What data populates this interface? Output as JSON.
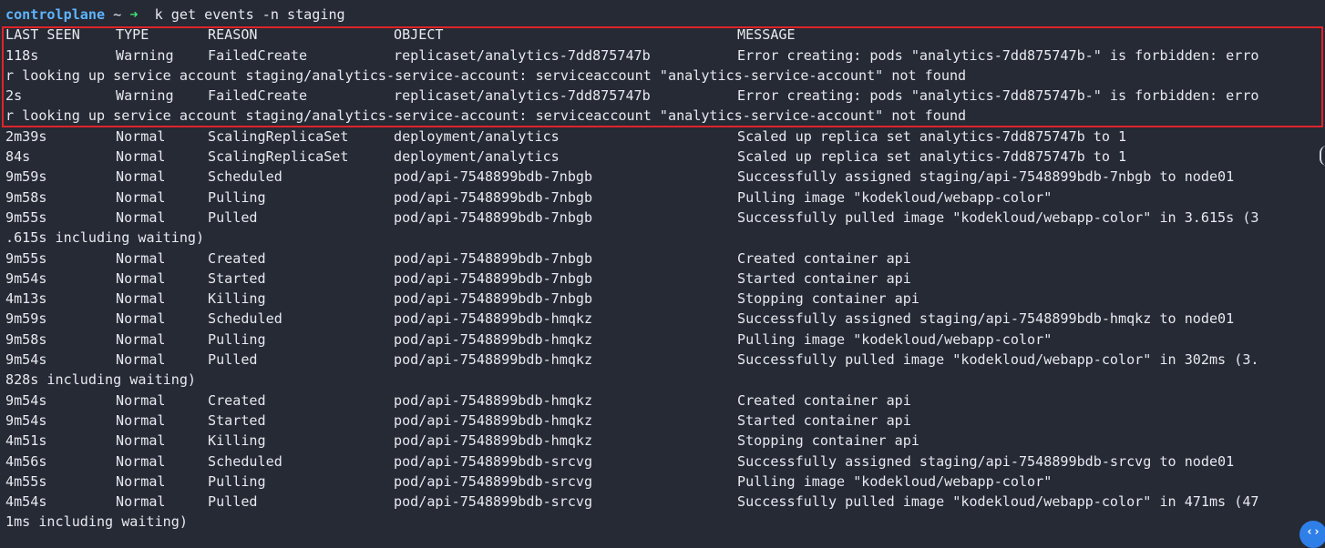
{
  "terminal": {
    "prompt": {
      "host": "controlplane",
      "tilde": "~",
      "arrow": "➜",
      "command": "k get events -n staging"
    },
    "header": {
      "last_seen": "LAST SEEN",
      "type": "TYPE",
      "reason": "REASON",
      "object": "OBJECT",
      "message": "MESSAGE"
    },
    "rows": [
      {
        "kind": "row",
        "last_seen": "118s",
        "type": "Warning",
        "reason": "FailedCreate",
        "object": "replicaset/analytics-7dd875747b",
        "message": "Error creating: pods \"analytics-7dd875747b-\" is forbidden: erro"
      },
      {
        "kind": "wrap",
        "text": "r looking up service account staging/analytics-service-account: serviceaccount \"analytics-service-account\" not found"
      },
      {
        "kind": "row",
        "last_seen": "2s",
        "type": "Warning",
        "reason": "FailedCreate",
        "object": "replicaset/analytics-7dd875747b",
        "message": "Error creating: pods \"analytics-7dd875747b-\" is forbidden: erro"
      },
      {
        "kind": "wrap",
        "text": "r looking up service account staging/analytics-service-account: serviceaccount \"analytics-service-account\" not found"
      },
      {
        "kind": "row",
        "last_seen": "2m39s",
        "type": "Normal",
        "reason": "ScalingReplicaSet",
        "object": "deployment/analytics",
        "message": "Scaled up replica set analytics-7dd875747b to 1"
      },
      {
        "kind": "row",
        "last_seen": "84s",
        "type": "Normal",
        "reason": "ScalingReplicaSet",
        "object": "deployment/analytics",
        "message": "Scaled up replica set analytics-7dd875747b to 1"
      },
      {
        "kind": "row",
        "last_seen": "9m59s",
        "type": "Normal",
        "reason": "Scheduled",
        "object": "pod/api-7548899bdb-7nbgb",
        "message": "Successfully assigned staging/api-7548899bdb-7nbgb to node01"
      },
      {
        "kind": "row",
        "last_seen": "9m58s",
        "type": "Normal",
        "reason": "Pulling",
        "object": "pod/api-7548899bdb-7nbgb",
        "message": "Pulling image \"kodekloud/webapp-color\""
      },
      {
        "kind": "row",
        "last_seen": "9m55s",
        "type": "Normal",
        "reason": "Pulled",
        "object": "pod/api-7548899bdb-7nbgb",
        "message": "Successfully pulled image \"kodekloud/webapp-color\" in 3.615s (3"
      },
      {
        "kind": "wrap",
        "text": ".615s including waiting)"
      },
      {
        "kind": "row",
        "last_seen": "9m55s",
        "type": "Normal",
        "reason": "Created",
        "object": "pod/api-7548899bdb-7nbgb",
        "message": "Created container api"
      },
      {
        "kind": "row",
        "last_seen": "9m54s",
        "type": "Normal",
        "reason": "Started",
        "object": "pod/api-7548899bdb-7nbgb",
        "message": "Started container api"
      },
      {
        "kind": "row",
        "last_seen": "4m13s",
        "type": "Normal",
        "reason": "Killing",
        "object": "pod/api-7548899bdb-7nbgb",
        "message": "Stopping container api"
      },
      {
        "kind": "row",
        "last_seen": "9m59s",
        "type": "Normal",
        "reason": "Scheduled",
        "object": "pod/api-7548899bdb-hmqkz",
        "message": "Successfully assigned staging/api-7548899bdb-hmqkz to node01"
      },
      {
        "kind": "row",
        "last_seen": "9m58s",
        "type": "Normal",
        "reason": "Pulling",
        "object": "pod/api-7548899bdb-hmqkz",
        "message": "Pulling image \"kodekloud/webapp-color\""
      },
      {
        "kind": "row",
        "last_seen": "9m54s",
        "type": "Normal",
        "reason": "Pulled",
        "object": "pod/api-7548899bdb-hmqkz",
        "message": "Successfully pulled image \"kodekloud/webapp-color\" in 302ms (3."
      },
      {
        "kind": "wrap",
        "text": "828s including waiting)"
      },
      {
        "kind": "row",
        "last_seen": "9m54s",
        "type": "Normal",
        "reason": "Created",
        "object": "pod/api-7548899bdb-hmqkz",
        "message": "Created container api"
      },
      {
        "kind": "row",
        "last_seen": "9m54s",
        "type": "Normal",
        "reason": "Started",
        "object": "pod/api-7548899bdb-hmqkz",
        "message": "Started container api"
      },
      {
        "kind": "row",
        "last_seen": "4m51s",
        "type": "Normal",
        "reason": "Killing",
        "object": "pod/api-7548899bdb-hmqkz",
        "message": "Stopping container api"
      },
      {
        "kind": "row",
        "last_seen": "4m56s",
        "type": "Normal",
        "reason": "Scheduled",
        "object": "pod/api-7548899bdb-srcvg",
        "message": "Successfully assigned staging/api-7548899bdb-srcvg to node01"
      },
      {
        "kind": "row",
        "last_seen": "4m55s",
        "type": "Normal",
        "reason": "Pulling",
        "object": "pod/api-7548899bdb-srcvg",
        "message": "Pulling image \"kodekloud/webapp-color\""
      },
      {
        "kind": "row",
        "last_seen": "4m54s",
        "type": "Normal",
        "reason": "Pulled",
        "object": "pod/api-7548899bdb-srcvg",
        "message": "Successfully pulled image \"kodekloud/webapp-color\" in 471ms (47"
      },
      {
        "kind": "wrap",
        "text": "1ms including waiting)"
      }
    ]
  },
  "overlay": {
    "corner_icon": "code-brackets-icon",
    "corner_icon_glyph": "‹›",
    "highlight_color": "#e0242b"
  },
  "colors": {
    "background": "#262a34",
    "foreground": "#e6e9ef",
    "prompt_host": "#5fb4ff",
    "prompt_arrow": "#3ee07a",
    "badge": "#2f7fe8"
  }
}
